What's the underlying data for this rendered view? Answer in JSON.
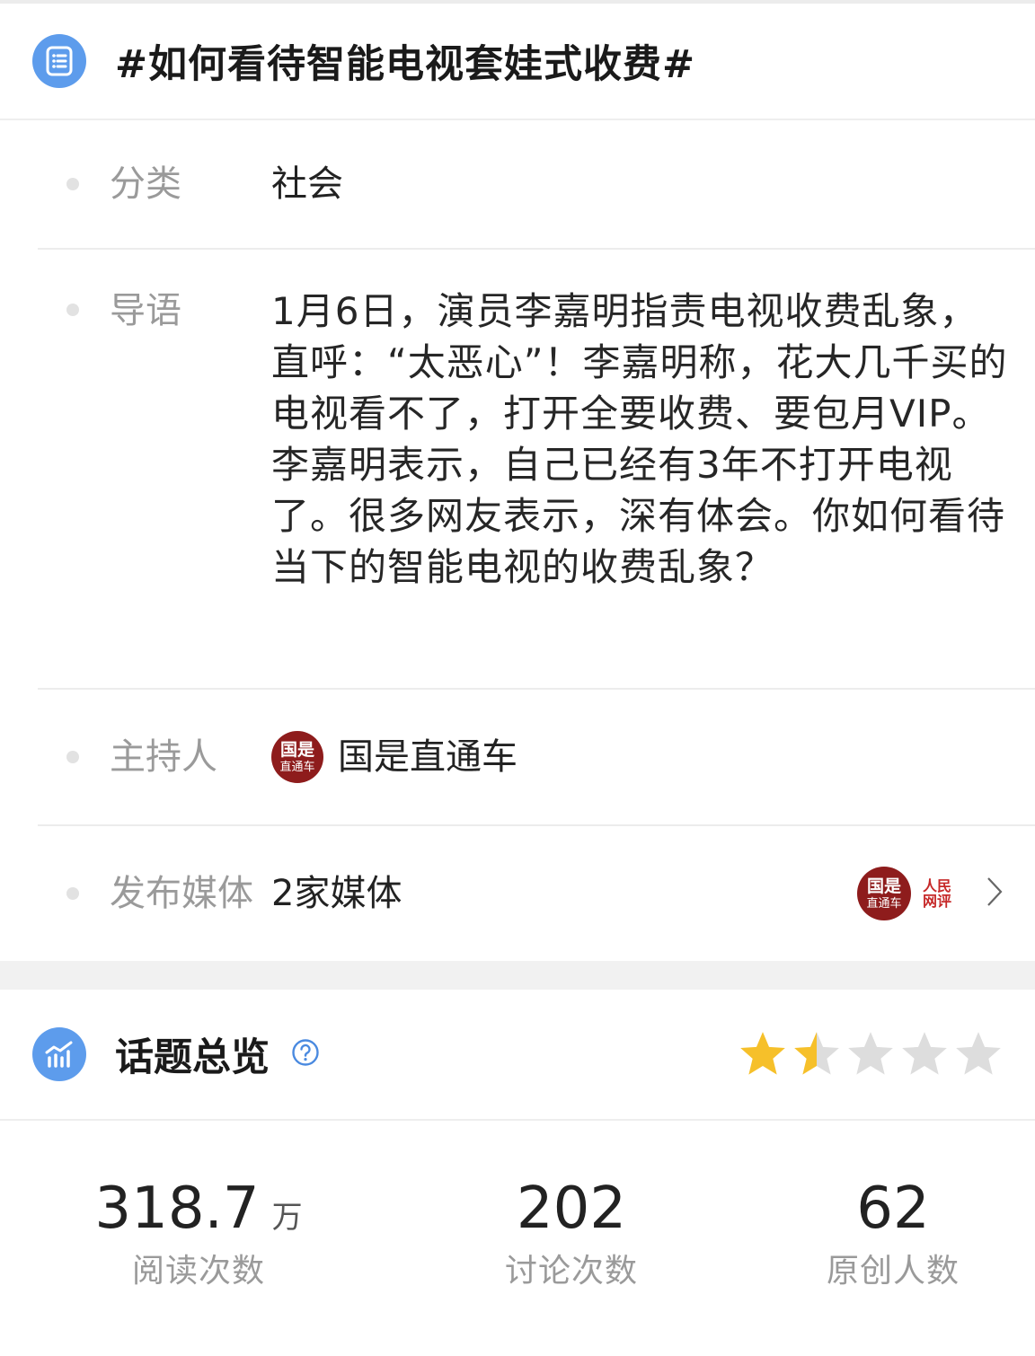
{
  "topic": {
    "title": "#如何看待智能电视套娃式收费#"
  },
  "info": {
    "category": {
      "label": "分类",
      "value": "社会"
    },
    "intro": {
      "label": "导语",
      "value": "1月6日，演员李嘉明指责电视收费乱象，直呼：“太恶心”！李嘉明称，花大几千买的电视看不了，打开全要收费、要包月VIP。李嘉明表示，自己已经有3年不打开电视了。很多网友表示，深有体会。你如何看待当下的智能电视的收费乱象？"
    },
    "host": {
      "label": "主持人",
      "name": "国是直通车",
      "logo_text": [
        "国是",
        "直通车"
      ]
    },
    "media": {
      "label": "发布媒体",
      "value": "2家媒体",
      "logo_text": [
        "国是",
        "直通车"
      ],
      "logo2_text": [
        "人民",
        "网评"
      ]
    }
  },
  "overview": {
    "title": "话题总览",
    "rating": 1.5,
    "rating_max": 5,
    "star_color": "#f6c02a",
    "star_empty_color": "#dddddd",
    "stats": {
      "reads": {
        "value": "318.7",
        "unit": "万",
        "label": "阅读次数"
      },
      "discussions": {
        "value": "202",
        "label": "讨论次数"
      },
      "originals": {
        "value": "62",
        "label": "原创人数"
      }
    }
  },
  "icons": {
    "header": "list-document-icon",
    "overview": "bar-chart-trend-icon",
    "help": "question-circle-icon",
    "chevron": "chevron-right-icon"
  },
  "colors": {
    "accent": "#5d9cec",
    "seal": "#8e1c1c",
    "rmw": "#c62828"
  }
}
